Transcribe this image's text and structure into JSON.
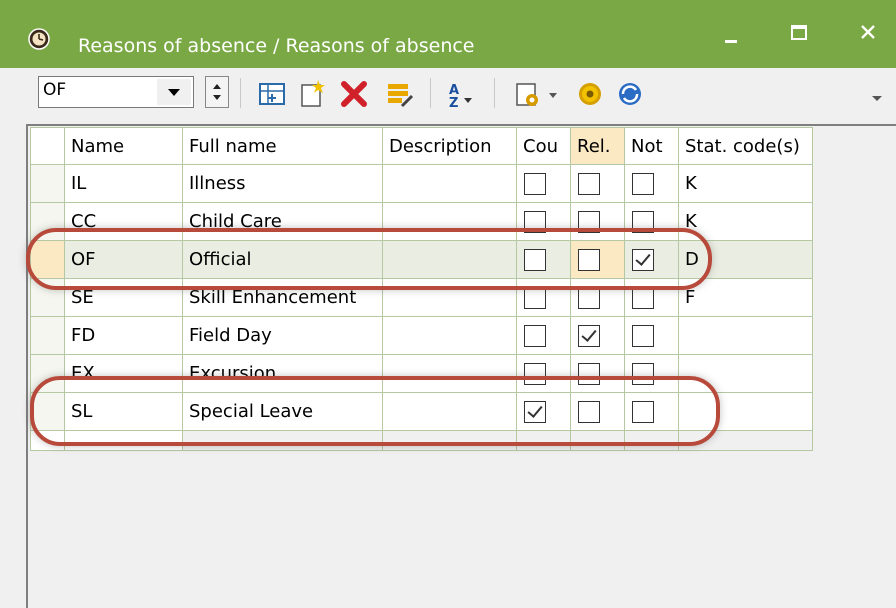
{
  "window": {
    "title": "Reasons of absence / Reasons of absence",
    "titlebar_color": "#7aa845"
  },
  "toolbar": {
    "combo_value": "OF",
    "icons": [
      "spinner",
      "new-table-icon",
      "new-record-icon",
      "delete-icon",
      "edit-icon",
      "sort-icon",
      "print-icon",
      "settings-icon",
      "refresh-icon"
    ]
  },
  "grid": {
    "columns": [
      "Name",
      "Full name",
      "Description",
      "Cou",
      "Rel.",
      "Not",
      "Stat. code(s)"
    ],
    "rows": [
      {
        "name": "IL",
        "full": "Illness",
        "desc": "",
        "cou": false,
        "rel": false,
        "not": false,
        "stat": "K"
      },
      {
        "name": "CC",
        "full": "Child Care",
        "desc": "",
        "cou": false,
        "rel": false,
        "not": false,
        "stat": "K"
      },
      {
        "name": "OF",
        "full": "Official",
        "desc": "",
        "cou": false,
        "rel": false,
        "not": true,
        "stat": "D"
      },
      {
        "name": "SE",
        "full": "Skill Enhancement",
        "desc": "",
        "cou": false,
        "rel": false,
        "not": false,
        "stat": "F"
      },
      {
        "name": "FD",
        "full": "Field Day",
        "desc": "",
        "cou": false,
        "rel": true,
        "not": false,
        "stat": ""
      },
      {
        "name": "EX",
        "full": "Excursion",
        "desc": "",
        "cou": false,
        "rel": false,
        "not": false,
        "stat": ""
      },
      {
        "name": "SL",
        "full": "Special Leave",
        "desc": "",
        "cou": true,
        "rel": false,
        "not": false,
        "stat": ""
      }
    ],
    "selected_row": "OF"
  },
  "annotation_color": "#b84a3c"
}
